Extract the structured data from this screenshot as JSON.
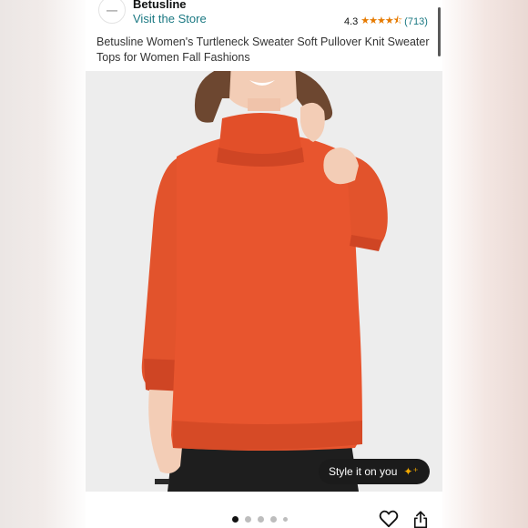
{
  "store": {
    "name": "Betusline",
    "visit_label": "Visit the Store",
    "rating": "4.3",
    "stars_icon": "star-rating-icon",
    "review_count": "(713)"
  },
  "product": {
    "title": "Betusline Women's Turtleneck Sweater Soft Pullover Knit Sweater Tops for Women Fall Fashions"
  },
  "gallery": {
    "style_button_label": "Style it on you",
    "style_button_icon": "sparkle-icon",
    "total_images": 5,
    "active_index": 0
  },
  "actions": {
    "favorite_icon": "heart-icon",
    "share_icon": "share-icon"
  },
  "colors": {
    "link": "#1a7882",
    "star": "#e67a00",
    "sweater": "#e8552e"
  }
}
